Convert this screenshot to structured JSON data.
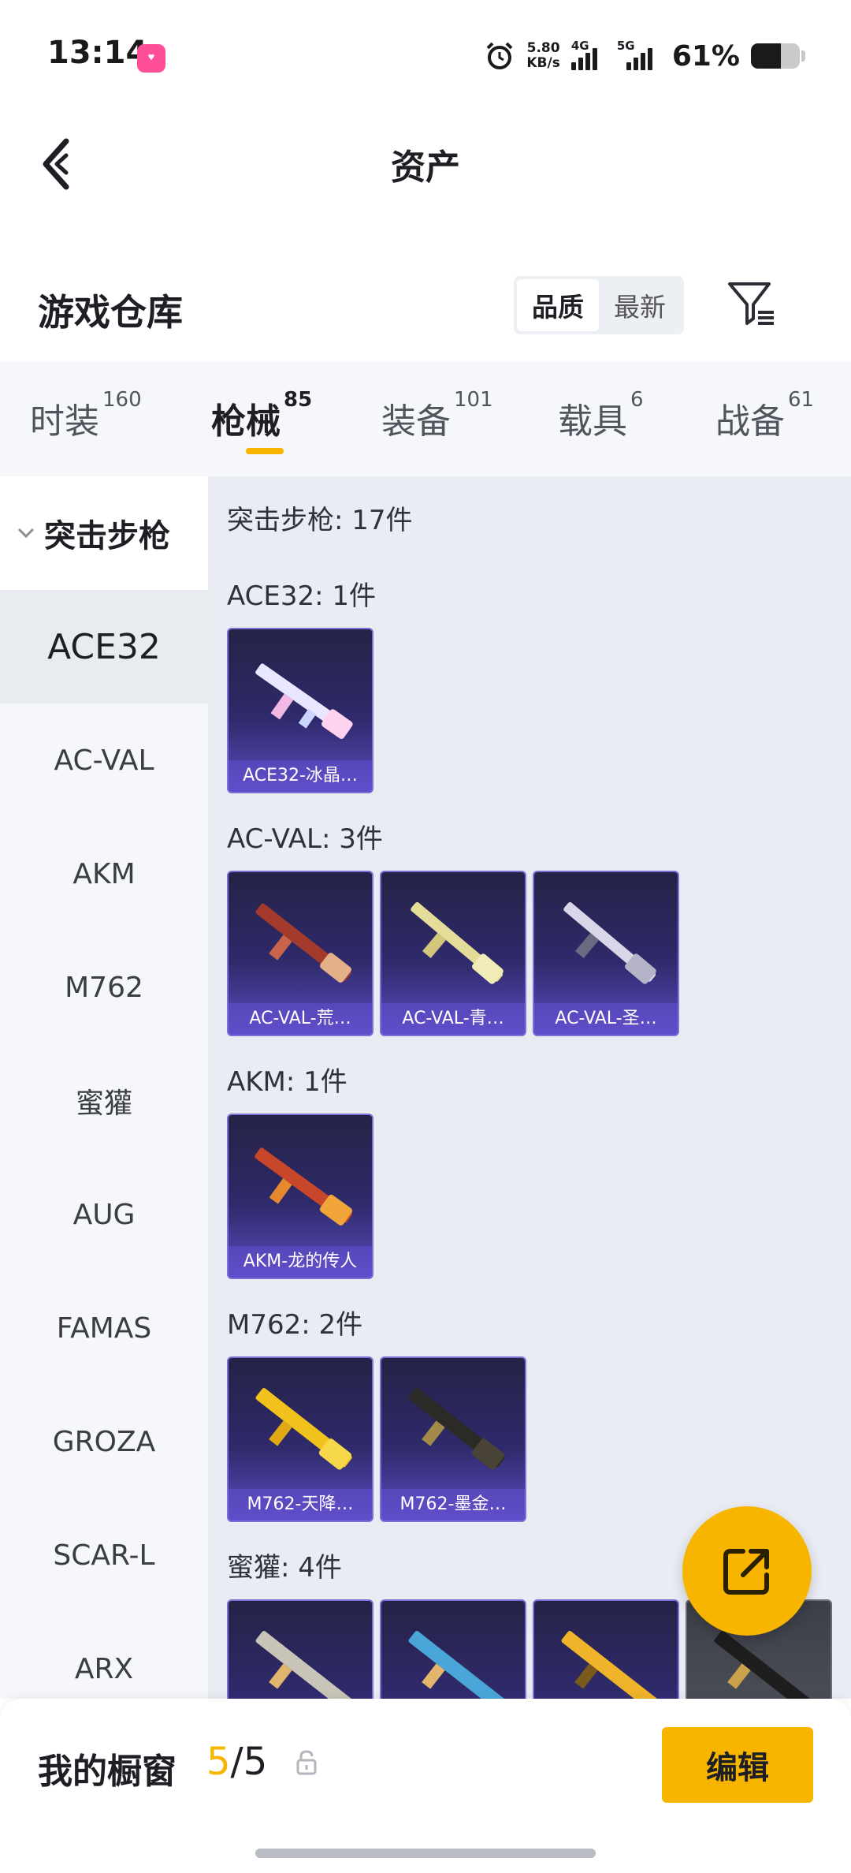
{
  "status_bar": {
    "time": "13:14",
    "net_speed_value": "5.80",
    "net_speed_unit": "KB/s",
    "network_1": "4G",
    "network_2": "5G",
    "battery_percent": "61%",
    "battery_level": 0.61
  },
  "header": {
    "title": "资产"
  },
  "warehouse": {
    "title": "游戏仓库",
    "sort_options": [
      "品质",
      "最新"
    ],
    "sort_selected": "品质"
  },
  "tabs": [
    {
      "label": "时装",
      "count": "160"
    },
    {
      "label": "枪械",
      "count": "85",
      "active": true
    },
    {
      "label": "装备",
      "count": "101"
    },
    {
      "label": "载具",
      "count": "6"
    },
    {
      "label": "战备",
      "count": "61"
    }
  ],
  "sidebar": {
    "group": "突击步枪",
    "items": [
      "ACE32",
      "AC-VAL",
      "AKM",
      "M762",
      "蜜獾",
      "AUG",
      "FAMAS",
      "GROZA",
      "SCAR-L",
      "ARX"
    ],
    "active": "ACE32"
  },
  "content": {
    "total": "突击步枪: 17件",
    "sections": [
      {
        "title": "ACE32: 1件",
        "items": [
          "ACE32-冰晶…"
        ]
      },
      {
        "title": "AC-VAL: 3件",
        "items": [
          "AC-VAL-荒…",
          "AC-VAL-青…",
          "AC-VAL-圣…"
        ]
      },
      {
        "title": "AKM: 1件",
        "items": [
          "AKM-龙的传人"
        ]
      },
      {
        "title": "M762: 2件",
        "items": [
          "M762-天降…",
          "M762-墨金…"
        ]
      },
      {
        "title": "蜜獾: 4件",
        "items": [
          "",
          "",
          "",
          ""
        ]
      }
    ]
  },
  "bottom": {
    "showcase_label": "我的橱窗",
    "showcase_current": "5",
    "showcase_sep": "/",
    "showcase_total": "5",
    "edit_label": "编辑"
  },
  "colors": {
    "accent": "#f7b500",
    "card_purple": "#2f2a6b",
    "card_border": "#7c6fd8"
  },
  "icons": [
    "back-arrow-icon",
    "filter-icon",
    "chevron-down-icon",
    "share-icon",
    "lock-icon",
    "alarm-icon"
  ]
}
